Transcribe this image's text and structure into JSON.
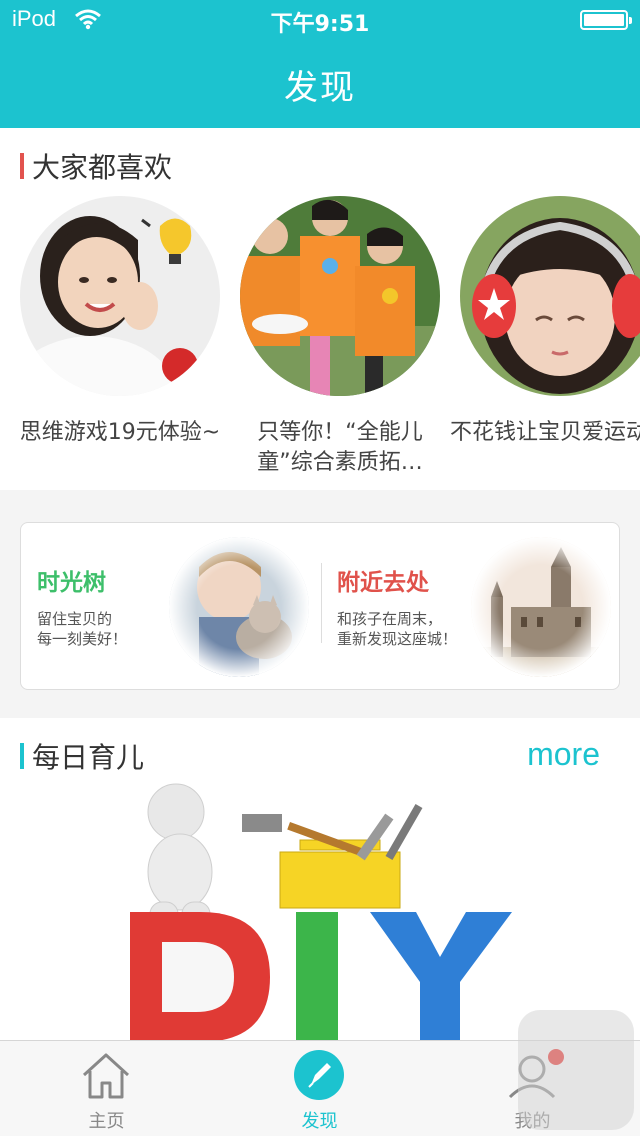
{
  "status": {
    "carrier": "iPod",
    "time": "下午9:51"
  },
  "nav": {
    "title": "发现"
  },
  "popular": {
    "heading": "大家都喜欢",
    "items": [
      {
        "caption": "思维游戏19元体验~"
      },
      {
        "caption": "只等你！“全能儿童”综合素质拓…"
      },
      {
        "caption": "不花钱让宝贝爱运动爱音乐爱创意"
      }
    ]
  },
  "features": {
    "left": {
      "title": "时光树",
      "desc_line1": "留住宝贝的",
      "desc_line2": "每一刻美好！"
    },
    "right": {
      "title": "附近去处",
      "desc_line1": "和孩子在周末，",
      "desc_line2": "重新发现这座城！"
    }
  },
  "daily": {
    "heading": "每日育儿",
    "more_label": "more"
  },
  "tabs": [
    {
      "label": "主页",
      "icon": "house-icon"
    },
    {
      "label": "发现",
      "icon": "compass-pen-icon"
    },
    {
      "label": "我的",
      "icon": "user-icon"
    }
  ],
  "colors": {
    "accent": "#1cc3cf",
    "popular_bar": "#e2534e",
    "daily_bar": "#1cc3cf",
    "green_title": "#3dbf6a",
    "red_title": "#e0524b",
    "badge": "#e8322e"
  }
}
